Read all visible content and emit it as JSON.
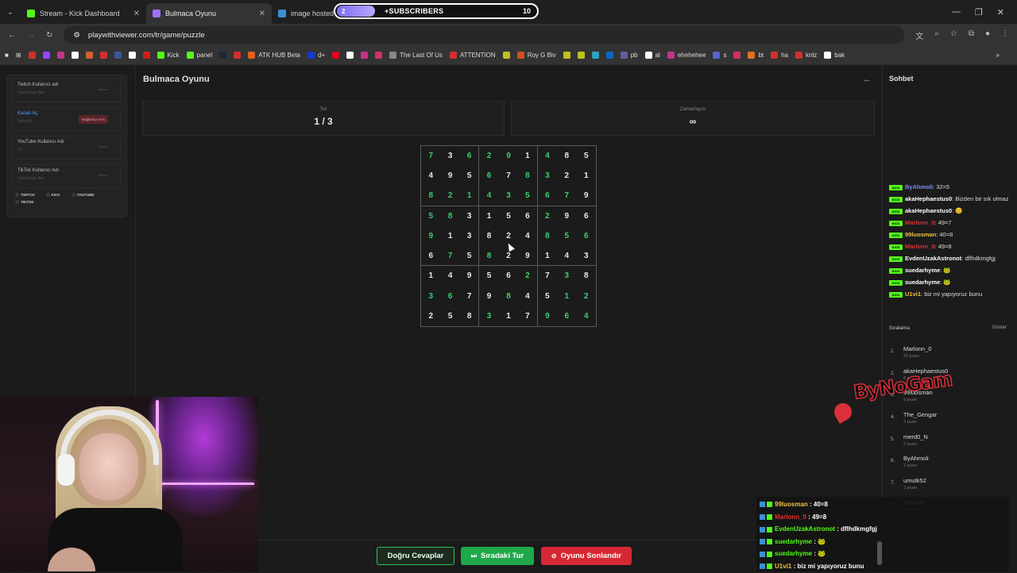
{
  "browser": {
    "tabs": [
      {
        "title": "Stream - Kick Dashboard",
        "color": "#53fc18",
        "active": false
      },
      {
        "title": "Bulmaca Oyunu",
        "color": "#a070ff",
        "active": true
      },
      {
        "title": "image hosted a",
        "color": "#3b8fd6",
        "active": false
      }
    ],
    "url": "playwithviewer.com/tr/game/puzzle",
    "bookmarks": [
      {
        "label": "",
        "color": "#d03030"
      },
      {
        "label": "",
        "color": "#9146ff"
      },
      {
        "label": "",
        "color": "#c13584"
      },
      {
        "label": "",
        "color": "#ffffff"
      },
      {
        "label": "",
        "color": "#d06030"
      },
      {
        "label": "",
        "color": "#d03030"
      },
      {
        "label": "",
        "color": "#3b5998"
      },
      {
        "label": "",
        "color": "#ffffff"
      },
      {
        "label": "",
        "color": "#cc2020"
      },
      {
        "label": "Kick",
        "color": "#53fc18"
      },
      {
        "label": "panel",
        "color": "#53fc18"
      },
      {
        "label": "",
        "color": "#1b2838"
      },
      {
        "label": "",
        "color": "#d03030"
      },
      {
        "label": "ATK HUB Beta",
        "color": "#e06020"
      },
      {
        "label": "d+",
        "color": "#113ccf"
      },
      {
        "label": "",
        "color": "#e60023"
      },
      {
        "label": "",
        "color": "#ffffff"
      },
      {
        "label": "",
        "color": "#c13584"
      },
      {
        "label": "",
        "color": "#d03060"
      },
      {
        "label": "The Last Of Us",
        "color": "#888888"
      },
      {
        "label": "ATTENTION",
        "color": "#d03030"
      },
      {
        "label": "",
        "color": "#c0c020"
      },
      {
        "label": "Roy G Biv",
        "color": "#d05020"
      },
      {
        "label": "",
        "color": "#c0c020"
      },
      {
        "label": "",
        "color": "#c0c020"
      },
      {
        "label": "",
        "color": "#30a0c0"
      },
      {
        "label": "",
        "color": "#0a66c2"
      },
      {
        "label": "pb",
        "color": "#6060a0"
      },
      {
        "label": "al",
        "color": "#ffffff"
      },
      {
        "label": "ehehehee",
        "color": "#c13584"
      },
      {
        "label": "s",
        "color": "#6060d0"
      },
      {
        "label": "",
        "color": "#d03060"
      },
      {
        "label": "bt",
        "color": "#e07020"
      },
      {
        "label": "ha",
        "color": "#d03030"
      },
      {
        "label": "knlz",
        "color": "#d03030"
      },
      {
        "label": "bak",
        "color": "#ffffff"
      }
    ]
  },
  "subs_overlay": {
    "count": "2",
    "label": "+SUBSCRIBERS",
    "goal": "10"
  },
  "left_panel": {
    "items": [
      {
        "title": "Twitch Kullanıcı adı",
        "sub": "Canal Kısa Adı",
        "tag": "Bağlan"
      },
      {
        "title": "Kanalı Aç",
        "sub": "Sulu şöl",
        "button": "Bağlantıyı Kes"
      },
      {
        "title": "YouTube Kullanıcı Adı",
        "sub": "UC...",
        "tag": "Bağlan"
      },
      {
        "title": "TikTok Kullanıcı Adı",
        "sub": "Canal Kısa Adı",
        "tag": "Bağlan"
      }
    ],
    "chips": [
      "TWITCH",
      "KICK",
      "YOUTUBE",
      "TIKTOK"
    ]
  },
  "game": {
    "title": "Bulmaca Oyunu",
    "round_label": "Tur",
    "round_value": "1 / 3",
    "timer_label": "Zamanlayıcı",
    "timer_value": "∞"
  },
  "sudoku": {
    "grid": [
      [
        "7",
        "3",
        "6",
        "2",
        "9",
        "1",
        "4",
        "8",
        "5"
      ],
      [
        "4",
        "9",
        "5",
        "6",
        "7",
        "8",
        "3",
        "2",
        "1"
      ],
      [
        "8",
        "2",
        "1",
        "4",
        "3",
        "5",
        "6",
        "7",
        "9"
      ],
      [
        "5",
        "8",
        "3",
        "1",
        "5",
        "6",
        "2",
        "9",
        "6"
      ],
      [
        "9",
        "1",
        "3",
        "8",
        "2",
        "4",
        "8",
        "5",
        "6"
      ],
      [
        "6",
        "7",
        "5",
        "8",
        "2",
        "9",
        "1",
        "4",
        "3"
      ],
      [
        "1",
        "4",
        "9",
        "5",
        "6",
        "2",
        "7",
        "3",
        "8"
      ],
      [
        "3",
        "6",
        "7",
        "9",
        "8",
        "4",
        "5",
        "1",
        "2"
      ],
      [
        "2",
        "5",
        "8",
        "3",
        "1",
        "7",
        "9",
        "6",
        "4"
      ]
    ],
    "green": [
      [
        1,
        0,
        1,
        1,
        1,
        0,
        1,
        0,
        0
      ],
      [
        0,
        0,
        0,
        1,
        0,
        1,
        1,
        0,
        0
      ],
      [
        1,
        1,
        1,
        1,
        1,
        1,
        1,
        1,
        0
      ],
      [
        1,
        1,
        0,
        0,
        0,
        0,
        1,
        0,
        0
      ],
      [
        1,
        0,
        0,
        0,
        0,
        0,
        1,
        1,
        1
      ],
      [
        0,
        1,
        0,
        1,
        0,
        0,
        0,
        0,
        0
      ],
      [
        0,
        0,
        0,
        0,
        0,
        1,
        0,
        1,
        0
      ],
      [
        1,
        1,
        0,
        0,
        1,
        0,
        0,
        1,
        1
      ],
      [
        0,
        0,
        0,
        1,
        0,
        0,
        1,
        1,
        1
      ]
    ]
  },
  "buttons": {
    "correct": "Doğru Cevaplar",
    "next": "Sıradaki Tur",
    "end": "Oyunu Sonlandır"
  },
  "chat": {
    "title": "Sohbet",
    "messages": [
      {
        "user": "ByAhmoli",
        "color": "#7b8cff",
        "text": "32=5"
      },
      {
        "user": "akaHephaestus0",
        "color": "#ffffff",
        "text": "Bizden bir sık olmaz"
      },
      {
        "user": "akaHephaestus0",
        "color": "#ffffff",
        "text": "😊"
      },
      {
        "user": "Marlonn_0",
        "color": "#e03030",
        "text": "49=7"
      },
      {
        "user": "99luosman",
        "color": "#f0c040",
        "text": "40=8"
      },
      {
        "user": "Marlonn_0",
        "color": "#e03030",
        "text": "49=8"
      },
      {
        "user": "EvdenUzakAstronot",
        "color": "#ffffff",
        "text": "dflhdkmgfgj"
      },
      {
        "user": "suedarhyme",
        "color": "#ffffff",
        "text": "🐸"
      },
      {
        "user": "suedarhyme",
        "color": "#ffffff",
        "text": "🐸"
      },
      {
        "user": "U1vi1",
        "color": "#f0c040",
        "text": "biz mi yapıyoruz bunu"
      }
    ],
    "leaderboard_title": "Sıralama",
    "show_label": "Göster",
    "leaderboard": [
      {
        "rank": "1.",
        "name": "Marlonn_0",
        "points": "20 puan"
      },
      {
        "rank": "2.",
        "name": "akaHephaestus0",
        "points": "8 puan"
      },
      {
        "rank": "3.",
        "name": "99luosman",
        "points": "5 puan"
      },
      {
        "rank": "4.",
        "name": "The_Gengar",
        "points": "3 puan"
      },
      {
        "rank": "5.",
        "name": "merd0_N",
        "points": "2 puan"
      },
      {
        "rank": "6.",
        "name": "ByAhmoli",
        "points": "2 puan"
      },
      {
        "rank": "7.",
        "name": "umutk52",
        "points": "2 puan"
      },
      {
        "rank": "8.",
        "name": "Tulaychi",
        "points": "1 puan"
      }
    ]
  },
  "overlay_logo": "ByNoGam",
  "chat_overlay": [
    {
      "user": "99luosman",
      "color": "#f0c040",
      "text": "40=8"
    },
    {
      "user": "Marlonn_0",
      "color": "#e03030",
      "text": "49=8"
    },
    {
      "user": "EvdenUzakAstronot",
      "color": "#53fc18",
      "text": "dflhdkmgfgj"
    },
    {
      "user": "suedarhyme",
      "color": "#53fc18",
      "text": "🐸"
    },
    {
      "user": "suedarhyme",
      "color": "#53fc18",
      "text": "🐸"
    },
    {
      "user": "U1vi1",
      "color": "#f0c040",
      "text": "biz mi yapıyoruz bunu"
    }
  ]
}
